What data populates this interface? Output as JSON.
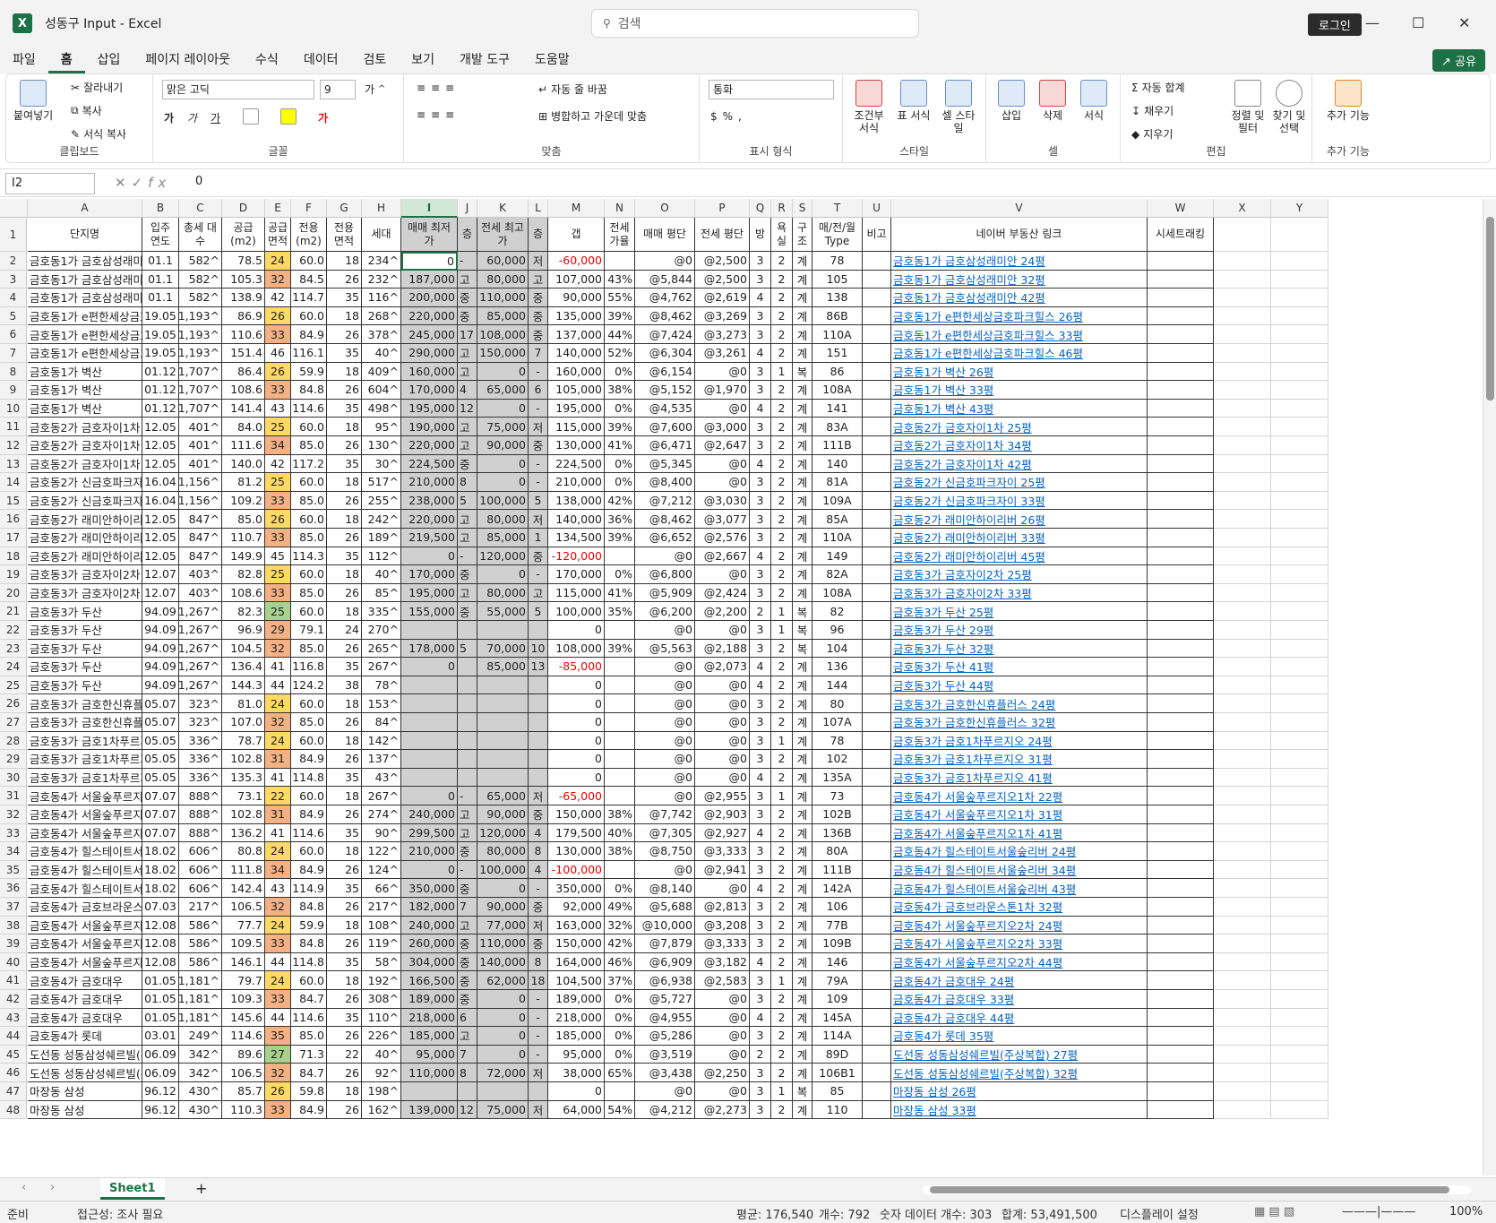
{
  "window": {
    "title": "성동구 Input  -  Excel",
    "search_placeholder": "검색",
    "login": "로그인",
    "share": "공유"
  },
  "menu": [
    "파일",
    "홈",
    "삽입",
    "페이지 레이아웃",
    "수식",
    "데이터",
    "검토",
    "보기",
    "개발 도구",
    "도움말"
  ],
  "ribbon": {
    "paste": "붙여넣기",
    "cut": "잘라내기",
    "copy": "복사",
    "format_painter": "서식 복사",
    "clipboard": "클립보드",
    "font_name": "맑은 고딕",
    "font_size": "9",
    "font": "글꼴",
    "wrap": "자동 줄 바꿈",
    "merge": "병합하고 가운데 맞춤",
    "align": "맞춤",
    "number_format": "통화",
    "number": "표시 형식",
    "cond_fmt": "조건부 서식",
    "table_fmt": "표 서식",
    "cell_style": "셀 스타일",
    "styles": "스타일",
    "insert": "삽입",
    "delete": "삭제",
    "format": "서식",
    "cells": "셀",
    "autosum": "자동 합계",
    "fill": "채우기",
    "clear": "지우기",
    "sort": "정렬 및 필터",
    "find": "찾기 및 선택",
    "editing": "편집",
    "addin": "추가 기능",
    "addins": "추가 기능"
  },
  "formula": {
    "namebox": "I2",
    "value": "0"
  },
  "columns": [
    "A",
    "B",
    "C",
    "D",
    "E",
    "F",
    "G",
    "H",
    "I",
    "J",
    "K",
    "L",
    "M",
    "N",
    "O",
    "P",
    "Q",
    "R",
    "S",
    "T",
    "U",
    "V",
    "W",
    "X",
    "Y"
  ],
  "headers": [
    "단지명",
    "입주 연도",
    "총세 대수",
    "공급 (m2)",
    "공급 면적",
    "전용 (m2)",
    "전용 면적",
    "세대",
    "매매 최저가",
    "층",
    "전세 최고가",
    "층",
    "갭",
    "전세 가율",
    "매매 평단",
    "전세 평단",
    "방",
    "욕실",
    "구조",
    "매/전/월 Type",
    "비고",
    "네이버 부동산 링크",
    "시세트래킹"
  ],
  "rows": [
    [
      "금호동1가 금호삼성래미안",
      "01.1",
      "582^",
      "78.5",
      "24",
      "60.0",
      "18",
      "234^",
      "0",
      "-",
      "60,000",
      "저",
      "-60,000",
      "",
      "@0",
      "@2,500",
      "3",
      "2",
      "계",
      "78",
      "",
      "금호동1가 금호삼성래미안 24평"
    ],
    [
      "금호동1가 금호삼성래미안",
      "01.1",
      "582^",
      "105.3",
      "32",
      "84.5",
      "26",
      "232^",
      "187,000",
      "고",
      "80,000",
      "고",
      "107,000",
      "43%",
      "@5,844",
      "@2,500",
      "3",
      "2",
      "계",
      "105",
      "",
      "금호동1가 금호삼성래미안 32평"
    ],
    [
      "금호동1가 금호삼성래미안",
      "01.1",
      "582^",
      "138.9",
      "42",
      "114.7",
      "35",
      "116^",
      "200,000",
      "중",
      "110,000",
      "중",
      "90,000",
      "55%",
      "@4,762",
      "@2,619",
      "4",
      "2",
      "계",
      "138",
      "",
      "금호동1가 금호삼성래미안 42평"
    ],
    [
      "금호동1가 e편한세상금호파크힐스",
      "19.05",
      "1,193^",
      "86.9",
      "26",
      "60.0",
      "18",
      "268^",
      "220,000",
      "중",
      "85,000",
      "중",
      "135,000",
      "39%",
      "@8,462",
      "@3,269",
      "3",
      "2",
      "계",
      "86B",
      "",
      "금호동1가 e편한세상금호파크힐스 26평"
    ],
    [
      "금호동1가 e편한세상금호파크힐스",
      "19.05",
      "1,193^",
      "110.6",
      "33",
      "84.9",
      "26",
      "378^",
      "245,000",
      "17",
      "108,000",
      "중",
      "137,000",
      "44%",
      "@7,424",
      "@3,273",
      "3",
      "2",
      "계",
      "110A",
      "",
      "금호동1가 e편한세상금호파크힐스 33평"
    ],
    [
      "금호동1가 e편한세상금호파크힐스",
      "19.05",
      "1,193^",
      "151.4",
      "46",
      "116.1",
      "35",
      "40^",
      "290,000",
      "고",
      "150,000",
      "7",
      "140,000",
      "52%",
      "@6,304",
      "@3,261",
      "4",
      "2",
      "계",
      "151",
      "",
      "금호동1가 e편한세상금호파크힐스 46평"
    ],
    [
      "금호동1가 벽산",
      "01.12",
      "1,707^",
      "86.4",
      "26",
      "59.9",
      "18",
      "409^",
      "160,000",
      "고",
      "0",
      "-",
      "160,000",
      "0%",
      "@6,154",
      "@0",
      "3",
      "1",
      "복",
      "86",
      "",
      "금호동1가 벽산 26평"
    ],
    [
      "금호동1가 벽산",
      "01.12",
      "1,707^",
      "108.6",
      "33",
      "84.8",
      "26",
      "604^",
      "170,000",
      "4",
      "65,000",
      "6",
      "105,000",
      "38%",
      "@5,152",
      "@1,970",
      "3",
      "2",
      "계",
      "108A",
      "",
      "금호동1가 벽산 33평"
    ],
    [
      "금호동1가 벽산",
      "01.12",
      "1,707^",
      "141.4",
      "43",
      "114.6",
      "35",
      "498^",
      "195,000",
      "12",
      "0",
      "-",
      "195,000",
      "0%",
      "@4,535",
      "@0",
      "4",
      "2",
      "계",
      "141",
      "",
      "금호동1가 벽산 43평"
    ],
    [
      "금호동2가 금호자이1차",
      "12.05",
      "401^",
      "84.0",
      "25",
      "60.0",
      "18",
      "95^",
      "190,000",
      "고",
      "75,000",
      "저",
      "115,000",
      "39%",
      "@7,600",
      "@3,000",
      "3",
      "2",
      "계",
      "83A",
      "",
      "금호동2가 금호자이1차 25평"
    ],
    [
      "금호동2가 금호자이1차",
      "12.05",
      "401^",
      "111.6",
      "34",
      "85.0",
      "26",
      "130^",
      "220,000",
      "고",
      "90,000",
      "중",
      "130,000",
      "41%",
      "@6,471",
      "@2,647",
      "3",
      "2",
      "계",
      "111B",
      "",
      "금호동2가 금호자이1차 34평"
    ],
    [
      "금호동2가 금호자이1차",
      "12.05",
      "401^",
      "140.0",
      "42",
      "117.2",
      "35",
      "30^",
      "224,500",
      "중",
      "0",
      "-",
      "224,500",
      "0%",
      "@5,345",
      "@0",
      "4",
      "2",
      "계",
      "140",
      "",
      "금호동2가 금호자이1차 42평"
    ],
    [
      "금호동2가 신금호파크자이",
      "16.04",
      "1,156^",
      "81.2",
      "25",
      "60.0",
      "18",
      "517^",
      "210,000",
      "8",
      "0",
      "-",
      "210,000",
      "0%",
      "@8,400",
      "@0",
      "3",
      "2",
      "계",
      "81A",
      "",
      "금호동2가 신금호파크자이 25평"
    ],
    [
      "금호동2가 신금호파크자이",
      "16.04",
      "1,156^",
      "109.2",
      "33",
      "85.0",
      "26",
      "255^",
      "238,000",
      "5",
      "100,000",
      "5",
      "138,000",
      "42%",
      "@7,212",
      "@3,030",
      "3",
      "2",
      "계",
      "109A",
      "",
      "금호동2가 신금호파크자이 33평"
    ],
    [
      "금호동2가 래미안하이리버",
      "12.05",
      "847^",
      "85.0",
      "26",
      "60.0",
      "18",
      "242^",
      "220,000",
      "고",
      "80,000",
      "저",
      "140,000",
      "36%",
      "@8,462",
      "@3,077",
      "3",
      "2",
      "계",
      "85A",
      "",
      "금호동2가 래미안하이리버 26평"
    ],
    [
      "금호동2가 래미안하이리버",
      "12.05",
      "847^",
      "110.7",
      "33",
      "85.0",
      "26",
      "189^",
      "219,500",
      "고",
      "85,000",
      "1",
      "134,500",
      "39%",
      "@6,652",
      "@2,576",
      "3",
      "2",
      "계",
      "110A",
      "",
      "금호동2가 래미안하이리버 33평"
    ],
    [
      "금호동2가 래미안하이리버",
      "12.05",
      "847^",
      "149.9",
      "45",
      "114.3",
      "35",
      "112^",
      "0",
      "-",
      "120,000",
      "중",
      "-120,000",
      "",
      "@0",
      "@2,667",
      "4",
      "2",
      "계",
      "149",
      "",
      "금호동2가 래미안하이리버 45평"
    ],
    [
      "금호동3가 금호자이2차",
      "12.07",
      "403^",
      "82.8",
      "25",
      "60.0",
      "18",
      "40^",
      "170,000",
      "중",
      "0",
      "-",
      "170,000",
      "0%",
      "@6,800",
      "@0",
      "3",
      "2",
      "계",
      "82A",
      "",
      "금호동3가 금호자이2차 25평"
    ],
    [
      "금호동3가 금호자이2차",
      "12.07",
      "403^",
      "108.6",
      "33",
      "85.0",
      "26",
      "85^",
      "195,000",
      "고",
      "80,000",
      "고",
      "115,000",
      "41%",
      "@5,909",
      "@2,424",
      "3",
      "2",
      "계",
      "108A",
      "",
      "금호동3가 금호자이2차 33평"
    ],
    [
      "금호동3가 두산",
      "94.09",
      "1,267^",
      "82.3",
      "25",
      "60.0",
      "18",
      "335^",
      "155,000",
      "중",
      "55,000",
      "5",
      "100,000",
      "35%",
      "@6,200",
      "@2,200",
      "2",
      "1",
      "복",
      "82",
      "",
      "금호동3가 두산 25평"
    ],
    [
      "금호동3가 두산",
      "94.09",
      "1,267^",
      "96.9",
      "29",
      "79.1",
      "24",
      "270^",
      "",
      "",
      "",
      "",
      "0",
      "",
      "@0",
      "@0",
      "3",
      "1",
      "복",
      "96",
      "",
      "금호동3가 두산 29평"
    ],
    [
      "금호동3가 두산",
      "94.09",
      "1,267^",
      "104.5",
      "32",
      "85.0",
      "26",
      "265^",
      "178,000",
      "5",
      "70,000",
      "10",
      "108,000",
      "39%",
      "@5,563",
      "@2,188",
      "3",
      "2",
      "복",
      "104",
      "",
      "금호동3가 두산 32평"
    ],
    [
      "금호동3가 두산",
      "94.09",
      "1,267^",
      "136.4",
      "41",
      "116.8",
      "35",
      "267^",
      "0",
      "",
      "85,000",
      "13",
      "-85,000",
      "",
      "@0",
      "@2,073",
      "4",
      "2",
      "계",
      "136",
      "",
      "금호동3가 두산 41평"
    ],
    [
      "금호동3가 두산",
      "94.09",
      "1,267^",
      "144.3",
      "44",
      "124.2",
      "38",
      "78^",
      "",
      "",
      "",
      "",
      "0",
      "",
      "@0",
      "@0",
      "4",
      "2",
      "계",
      "144",
      "",
      "금호동3가 두산 44평"
    ],
    [
      "금호동3가 금호한신휴플러스",
      "05.07",
      "323^",
      "81.0",
      "24",
      "60.0",
      "18",
      "153^",
      "",
      "",
      "",
      "",
      "0",
      "",
      "@0",
      "@0",
      "3",
      "2",
      "계",
      "80",
      "",
      "금호동3가 금호한신휴플러스 24평"
    ],
    [
      "금호동3가 금호한신휴플러스",
      "05.07",
      "323^",
      "107.0",
      "32",
      "85.0",
      "26",
      "84^",
      "",
      "",
      "",
      "",
      "0",
      "",
      "@0",
      "@0",
      "3",
      "2",
      "계",
      "107A",
      "",
      "금호동3가 금호한신휴플러스 32평"
    ],
    [
      "금호동3가 금호1차푸르지오",
      "05.05",
      "336^",
      "78.7",
      "24",
      "60.0",
      "18",
      "142^",
      "",
      "",
      "",
      "",
      "0",
      "",
      "@0",
      "@0",
      "3",
      "1",
      "계",
      "78",
      "",
      "금호동3가 금호1차푸르지오 24평"
    ],
    [
      "금호동3가 금호1차푸르지오",
      "05.05",
      "336^",
      "102.8",
      "31",
      "84.9",
      "26",
      "137^",
      "",
      "",
      "",
      "",
      "0",
      "",
      "@0",
      "@0",
      "3",
      "2",
      "계",
      "102",
      "",
      "금호동3가 금호1차푸르지오 31평"
    ],
    [
      "금호동3가 금호1차푸르지오",
      "05.05",
      "336^",
      "135.3",
      "41",
      "114.8",
      "35",
      "43^",
      "",
      "",
      "",
      "",
      "0",
      "",
      "@0",
      "@0",
      "4",
      "2",
      "계",
      "135A",
      "",
      "금호동3가 금호1차푸르지오 41평"
    ],
    [
      "금호동4가 서울숲푸르지오1차",
      "07.07",
      "888^",
      "73.1",
      "22",
      "60.0",
      "18",
      "267^",
      "0",
      "-",
      "65,000",
      "저",
      "-65,000",
      "",
      "@0",
      "@2,955",
      "3",
      "1",
      "계",
      "73",
      "",
      "금호동4가 서울숲푸르지오1차 22평"
    ],
    [
      "금호동4가 서울숲푸르지오1차",
      "07.07",
      "888^",
      "102.8",
      "31",
      "84.9",
      "26",
      "274^",
      "240,000",
      "고",
      "90,000",
      "중",
      "150,000",
      "38%",
      "@7,742",
      "@2,903",
      "3",
      "2",
      "계",
      "102B",
      "",
      "금호동4가 서울숲푸르지오1차 31평"
    ],
    [
      "금호동4가 서울숲푸르지오1차",
      "07.07",
      "888^",
      "136.2",
      "41",
      "114.6",
      "35",
      "90^",
      "299,500",
      "고",
      "120,000",
      "4",
      "179,500",
      "40%",
      "@7,305",
      "@2,927",
      "4",
      "2",
      "계",
      "136B",
      "",
      "금호동4가 서울숲푸르지오1차 41평"
    ],
    [
      "금호동4가 힐스테이트서울숲리버",
      "18.02",
      "606^",
      "80.8",
      "24",
      "60.0",
      "18",
      "122^",
      "210,000",
      "중",
      "80,000",
      "8",
      "130,000",
      "38%",
      "@8,750",
      "@3,333",
      "3",
      "2",
      "계",
      "80A",
      "",
      "금호동4가 힐스테이트서울숲리버 24평"
    ],
    [
      "금호동4가 힐스테이트서울숲리버",
      "18.02",
      "606^",
      "111.8",
      "34",
      "84.9",
      "26",
      "124^",
      "0",
      "-",
      "100,000",
      "4",
      "-100,000",
      "",
      "@0",
      "@2,941",
      "3",
      "2",
      "계",
      "111B",
      "",
      "금호동4가 힐스테이트서울숲리버 34평"
    ],
    [
      "금호동4가 힐스테이트서울숲리버",
      "18.02",
      "606^",
      "142.4",
      "43",
      "114.9",
      "35",
      "66^",
      "350,000",
      "중",
      "0",
      "-",
      "350,000",
      "0%",
      "@8,140",
      "@0",
      "4",
      "2",
      "계",
      "142A",
      "",
      "금호동4가 힐스테이트서울숲리버 43평"
    ],
    [
      "금호동4가 금호브라운스톤1차",
      "07.03",
      "217^",
      "106.5",
      "32",
      "84.8",
      "26",
      "217^",
      "182,000",
      "7",
      "90,000",
      "중",
      "92,000",
      "49%",
      "@5,688",
      "@2,813",
      "3",
      "2",
      "계",
      "106",
      "",
      "금호동4가 금호브라운스톤1차 32평"
    ],
    [
      "금호동4가 서울숲푸르지오2차",
      "12.08",
      "586^",
      "77.7",
      "24",
      "59.9",
      "18",
      "108^",
      "240,000",
      "고",
      "77,000",
      "저",
      "163,000",
      "32%",
      "@10,000",
      "@3,208",
      "3",
      "2",
      "계",
      "77B",
      "",
      "금호동4가 서울숲푸르지오2차 24평"
    ],
    [
      "금호동4가 서울숲푸르지오2차",
      "12.08",
      "586^",
      "109.5",
      "33",
      "84.8",
      "26",
      "119^",
      "260,000",
      "중",
      "110,000",
      "중",
      "150,000",
      "42%",
      "@7,879",
      "@3,333",
      "3",
      "2",
      "계",
      "109B",
      "",
      "금호동4가 서울숲푸르지오2차 33평"
    ],
    [
      "금호동4가 서울숲푸르지오2차",
      "12.08",
      "586^",
      "146.1",
      "44",
      "114.8",
      "35",
      "58^",
      "304,000",
      "중",
      "140,000",
      "8",
      "164,000",
      "46%",
      "@6,909",
      "@3,182",
      "4",
      "2",
      "계",
      "146",
      "",
      "금호동4가 서울숲푸르지오2차 44평"
    ],
    [
      "금호동4가 금호대우",
      "01.05",
      "1,181^",
      "79.7",
      "24",
      "60.0",
      "18",
      "192^",
      "166,500",
      "중",
      "62,000",
      "18",
      "104,500",
      "37%",
      "@6,938",
      "@2,583",
      "3",
      "1",
      "계",
      "79A",
      "",
      "금호동4가 금호대우 24평"
    ],
    [
      "금호동4가 금호대우",
      "01.05",
      "1,181^",
      "109.3",
      "33",
      "84.7",
      "26",
      "308^",
      "189,000",
      "중",
      "0",
      "-",
      "189,000",
      "0%",
      "@5,727",
      "@0",
      "3",
      "2",
      "계",
      "109",
      "",
      "금호동4가 금호대우 33평"
    ],
    [
      "금호동4가 금호대우",
      "01.05",
      "1,181^",
      "145.6",
      "44",
      "114.6",
      "35",
      "110^",
      "218,000",
      "6",
      "0",
      "-",
      "218,000",
      "0%",
      "@4,955",
      "@0",
      "4",
      "2",
      "계",
      "145A",
      "",
      "금호동4가 금호대우 44평"
    ],
    [
      "금호동4가 롯데",
      "03.01",
      "249^",
      "114.6",
      "35",
      "85.0",
      "26",
      "226^",
      "185,000",
      "고",
      "0",
      "-",
      "185,000",
      "0%",
      "@5,286",
      "@0",
      "3",
      "2",
      "계",
      "114A",
      "",
      "금호동4가 롯데 35평"
    ],
    [
      "도선동 성동삼성쉐르빌(주상복합)",
      "06.09",
      "342^",
      "89.6",
      "27",
      "71.3",
      "22",
      "40^",
      "95,000",
      "7",
      "0",
      "-",
      "95,000",
      "0%",
      "@3,519",
      "@0",
      "2",
      "2",
      "계",
      "89D",
      "",
      "도선동 성동삼성쉐르빌(주상복합) 27평"
    ],
    [
      "도선동 성동삼성쉐르빌(주상복합)",
      "06.09",
      "342^",
      "106.5",
      "32",
      "84.7",
      "26",
      "92^",
      "110,000",
      "8",
      "72,000",
      "저",
      "38,000",
      "65%",
      "@3,438",
      "@2,250",
      "3",
      "2",
      "계",
      "106B1",
      "",
      "도선동 성동삼성쉐르빌(주상복합) 32평"
    ],
    [
      "마장동 삼성",
      "96.12",
      "430^",
      "85.7",
      "26",
      "59.8",
      "18",
      "198^",
      "",
      "",
      "",
      "",
      "0",
      "",
      "@0",
      "@0",
      "3",
      "1",
      "복",
      "85",
      "",
      "마장동 삼성 26평"
    ],
    [
      "마장동 삼성",
      "96.12",
      "430^",
      "110.3",
      "33",
      "84.9",
      "26",
      "162^",
      "139,000",
      "12",
      "75,000",
      "저",
      "64,000",
      "54%",
      "@4,212",
      "@2,273",
      "3",
      "2",
      "계",
      "110",
      "",
      "마장동 삼성 33평"
    ]
  ],
  "sheet": {
    "tab": "Sheet1"
  },
  "status": {
    "ready": "준비",
    "access": "접근성: 조사 필요",
    "avg": "평균: 176,540",
    "count": "개수: 792",
    "numcount": "숫자 데이터 개수: 303",
    "sum": "합계: 53,491,500",
    "display": "디스플레이 설정",
    "zoom": "100%"
  }
}
